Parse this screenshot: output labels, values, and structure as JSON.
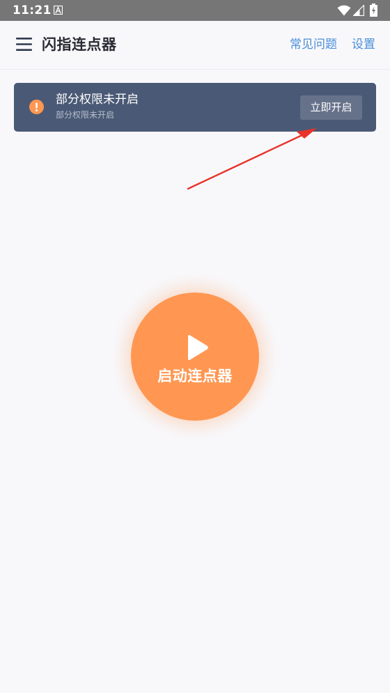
{
  "status_bar": {
    "time": "11:21",
    "icons": [
      "a-notification-icon",
      "wifi-icon",
      "signal-icon",
      "battery-charging-icon"
    ]
  },
  "app_bar": {
    "menu_icon": "hamburger-menu-icon",
    "title": "闪指连点器",
    "faq_label": "常见问题",
    "settings_label": "设置"
  },
  "permission_banner": {
    "icon": "warning-icon",
    "title": "部分权限未开启",
    "subtitle": "部分权限未开启",
    "button_label": "立即开启"
  },
  "start_button": {
    "icon": "play-icon",
    "label": "启动连点器"
  },
  "colors": {
    "accent": "#ff9752",
    "link": "#4a8fd9",
    "banner_bg": "#4a5975",
    "banner_button_bg": "#66728a",
    "annotation_arrow": "#e8342a",
    "status_bar_bg": "#767676",
    "page_bg": "#f8f8fb"
  }
}
